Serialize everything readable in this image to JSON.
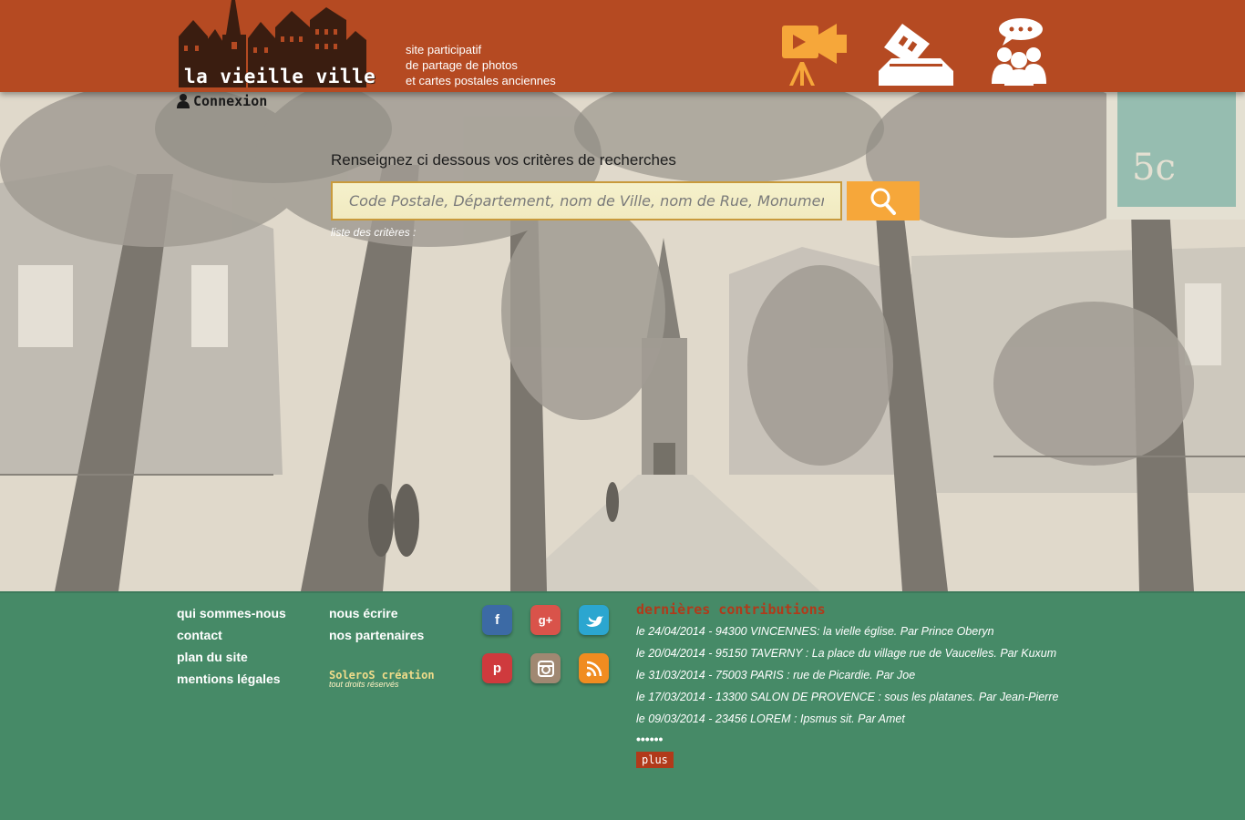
{
  "header": {
    "logo_text": "la vieille ville",
    "tagline": [
      "site participatif",
      "de partage de photos",
      "et cartes postales anciennes"
    ],
    "icons": [
      "video-camera-icon",
      "vote-ballot-icon",
      "community-chat-icon"
    ],
    "colors": {
      "bar": "#b54a22",
      "icon_orange": "#f6a73a"
    }
  },
  "auth": {
    "login_label": "Connexion"
  },
  "search": {
    "label": "Renseignez ci dessous vos critères de recherches",
    "placeholder": "Code Postale, Département, nom de Ville, nom de Rue, Monument ...",
    "criteria_link": "liste des critères :",
    "button_icon": "magnifier-icon"
  },
  "footer": {
    "links_col1": [
      "qui sommes-nous",
      "contact",
      "plan du site",
      "mentions légales"
    ],
    "links_col2": [
      "nous écrire",
      "nos partenaires"
    ],
    "credit_brand": "SoleroS création",
    "credit_rights": "tout droits réservés",
    "social": [
      "facebook-icon",
      "google-plus-icon",
      "twitter-icon",
      "pinterest-icon",
      "instagram-icon",
      "rss-icon"
    ],
    "colors": {
      "background": "#468a67",
      "accent": "#b13a1a"
    }
  },
  "contributions": {
    "title": "dernières contributions",
    "items": [
      "le 24/04/2014 - 94300 VINCENNES: la vielle église.  Par Prince Oberyn",
      "le 20/04/2014 - 95150 TAVERNY : La place du village rue de Vaucelles.  Par Kuxum",
      "le 31/03/2014 - 75003 PARIS : rue de Picardie.  Par Joe",
      "le 17/03/2014 - 13300 SALON DE PROVENCE : sous les platanes.  Par Jean-Pierre",
      "le 09/03/2014 - 23456 LOREM : Ipsmus sit. Par Amet"
    ],
    "more_dots": "••••••",
    "more_label": "plus"
  }
}
